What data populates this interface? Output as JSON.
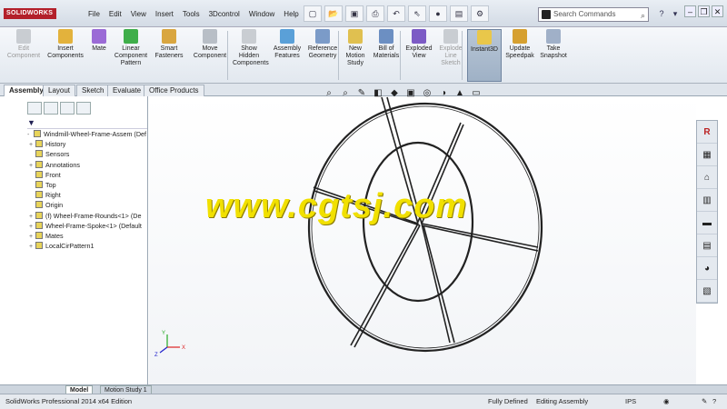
{
  "app": {
    "logo": "SOLIDWORKS"
  },
  "menu": [
    "File",
    "Edit",
    "View",
    "Insert",
    "Tools",
    "3Dcontrol",
    "Window",
    "Help"
  ],
  "search": {
    "placeholder": "Search Commands"
  },
  "ribbon": [
    {
      "label": "Edit Component",
      "disabled": true
    },
    {
      "label": "Insert Components",
      "disabled": false
    },
    {
      "label": "Mate",
      "disabled": false
    },
    {
      "label": "Linear Component Pattern",
      "disabled": false
    },
    {
      "label": "Smart Fasteners",
      "disabled": false
    },
    {
      "label": "Move Component",
      "disabled": false
    },
    {
      "label": "Show Hidden Components",
      "disabled": false
    },
    {
      "label": "Assembly Features",
      "disabled": false
    },
    {
      "label": "Reference Geometry",
      "disabled": false
    },
    {
      "label": "New Motion Study",
      "disabled": false
    },
    {
      "label": "Bill of Materials",
      "disabled": false
    },
    {
      "label": "Exploded View",
      "disabled": false
    },
    {
      "label": "Explode Line Sketch",
      "disabled": true
    },
    {
      "label": "Instant3D",
      "disabled": false
    },
    {
      "label": "Update Speedpak",
      "disabled": false
    },
    {
      "label": "Take Snapshot",
      "disabled": false
    }
  ],
  "tabs": [
    "Assembly",
    "Layout",
    "Sketch",
    "Evaluate",
    "Office Products"
  ],
  "tree": [
    {
      "label": "Windmill-Wheel-Frame-Assem  (Def",
      "exp": "-"
    },
    {
      "label": "History",
      "exp": "+"
    },
    {
      "label": "Sensors",
      "exp": ""
    },
    {
      "label": "Annotations",
      "exp": "+"
    },
    {
      "label": "Front",
      "exp": ""
    },
    {
      "label": "Top",
      "exp": ""
    },
    {
      "label": "Right",
      "exp": ""
    },
    {
      "label": "Origin",
      "exp": ""
    },
    {
      "label": "(f) Wheel-Frame-Rounds<1> (De",
      "exp": "+"
    },
    {
      "label": "Wheel-Frame-Spoke<1> (Default",
      "exp": "+"
    },
    {
      "label": "Mates",
      "exp": "+"
    },
    {
      "label": "LocalCirPattern1",
      "exp": "+"
    }
  ],
  "watermark": "www.cgtsj.com",
  "bottom_tabs": [
    "Model",
    "Motion Study 1"
  ],
  "status": {
    "edition": "SolidWorks Professional 2014 x64 Edition",
    "defined": "Fully Defined",
    "mode": "Editing Assembly",
    "units": "IPS"
  }
}
